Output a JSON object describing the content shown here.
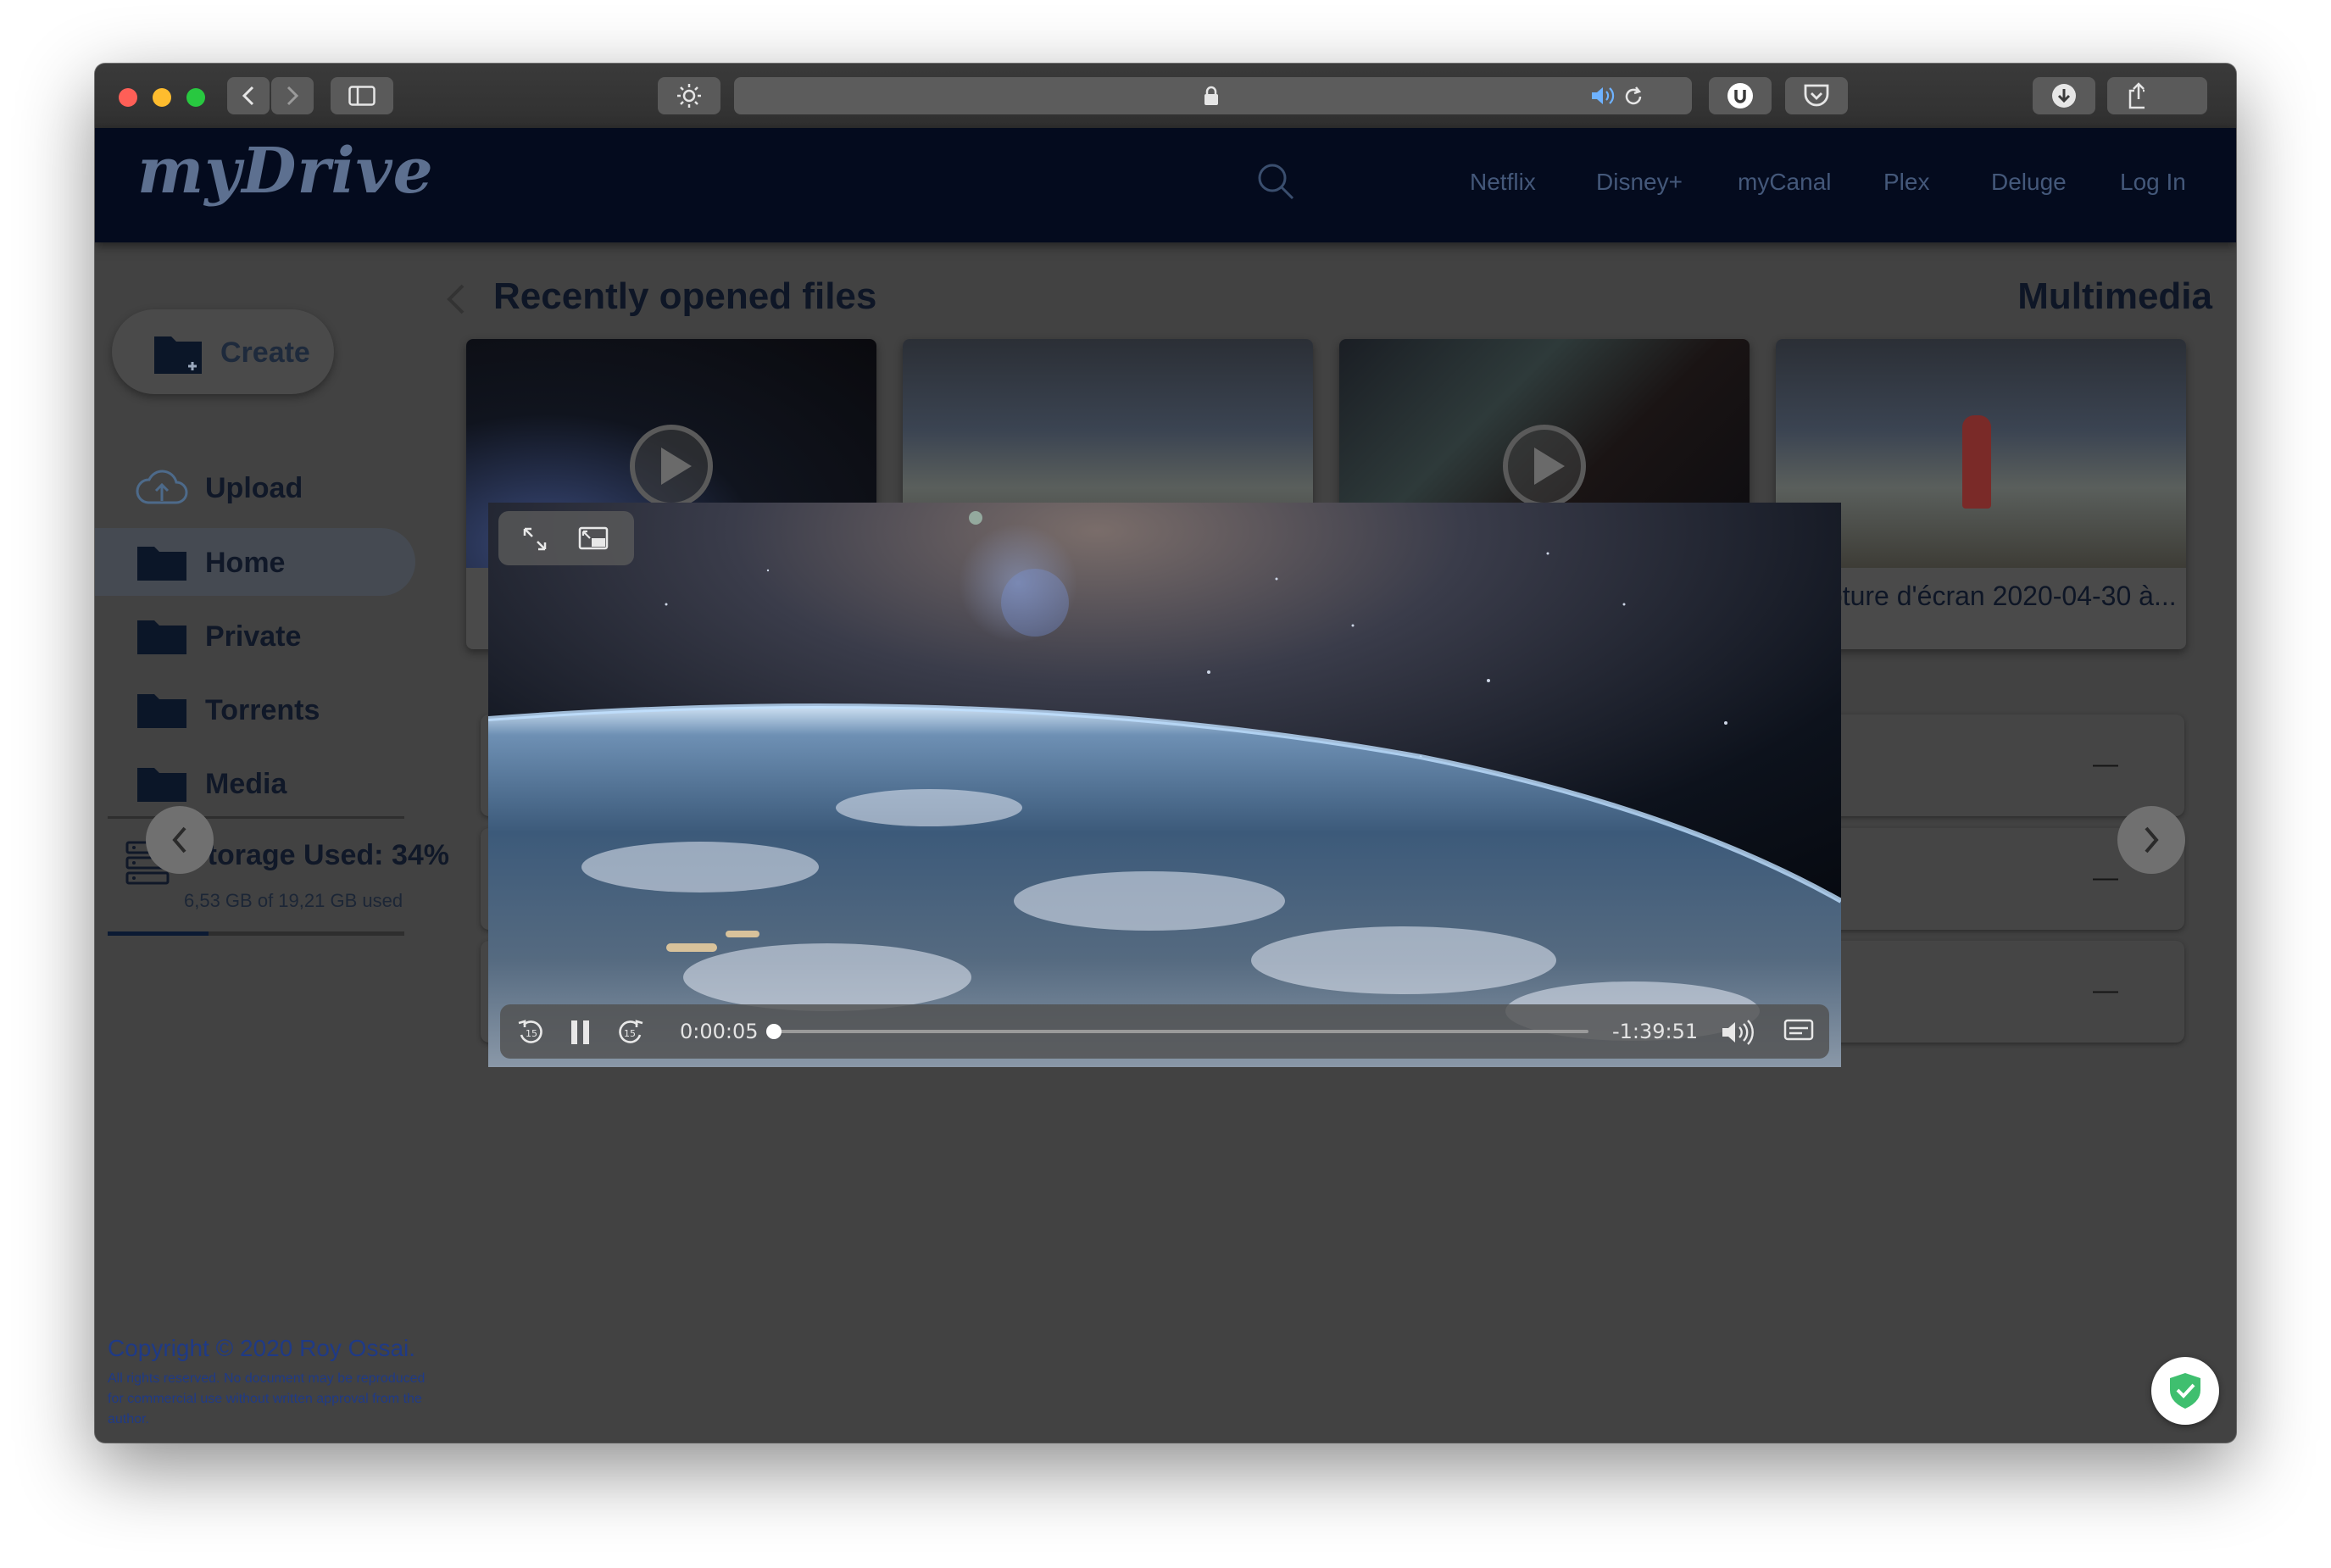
{
  "browser": {
    "traffic_lights": {
      "close": "#fe5f57",
      "minimize": "#febc2e",
      "zoom": "#28c840"
    }
  },
  "app": {
    "logo": "myDrive",
    "nav": [
      "Netflix",
      "Disney+",
      "myCanal",
      "Plex",
      "Deluge",
      "Log In"
    ]
  },
  "sidebar": {
    "create_label": "Create",
    "items": [
      {
        "label": "Upload",
        "icon": "cloud-upload-icon"
      },
      {
        "label": "Home",
        "icon": "folder-icon"
      },
      {
        "label": "Private",
        "icon": "folder-icon"
      },
      {
        "label": "Torrents",
        "icon": "folder-icon"
      },
      {
        "label": "Media",
        "icon": "folder-icon"
      }
    ],
    "storage": {
      "title": "Storage Used: 34%",
      "sub": "6,53 GB of 19,21 GB used",
      "percent": 34
    },
    "copyright": "Copyright © 2020 Roy Ossai.",
    "rights": "All rights reserved. No document may be reproduced for commercial use without written approval from the author."
  },
  "main": {
    "title": "Recently opened files",
    "right_title": "Multimedia",
    "cards": [
      {
        "name": ""
      },
      {
        "name": ""
      },
      {
        "name": ""
      },
      {
        "name": "Capture d'écran 2020-04-30 à..."
      }
    ],
    "row_dashes": [
      "—",
      "—",
      "—"
    ]
  },
  "player": {
    "elapsed": "0:00:05",
    "remaining": "-1:39:51",
    "progress": 0.005
  },
  "colors": {
    "header_bg": "#040b1e",
    "overlay_bg": "#424242",
    "nav_text": "#44587a",
    "copyright_text": "#1f3a86"
  }
}
